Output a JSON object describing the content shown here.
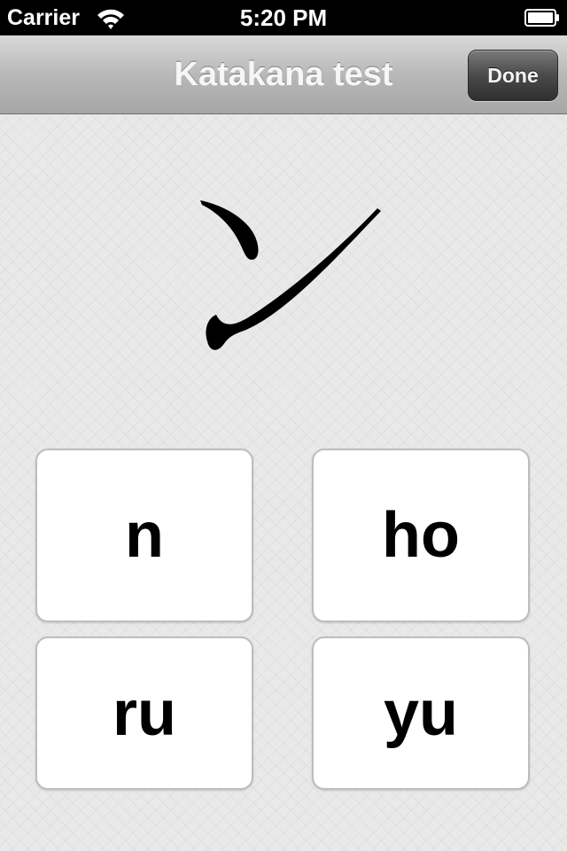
{
  "status_bar": {
    "carrier": "Carrier",
    "time": "5:20 PM",
    "wifi_icon": "wifi-icon",
    "battery_icon": "battery-icon"
  },
  "nav_bar": {
    "title": "Katakana test",
    "done_label": "Done"
  },
  "question": {
    "character_icon": "katakana-n-glyph"
  },
  "answers": [
    {
      "label": "n"
    },
    {
      "label": "ho"
    },
    {
      "label": "ru"
    },
    {
      "label": "yu"
    }
  ],
  "colors": {
    "nav_background": "#b8b8b8",
    "done_button": "#4a4a4a",
    "content_background": "#e9e9e9",
    "answer_button": "#ffffff"
  }
}
